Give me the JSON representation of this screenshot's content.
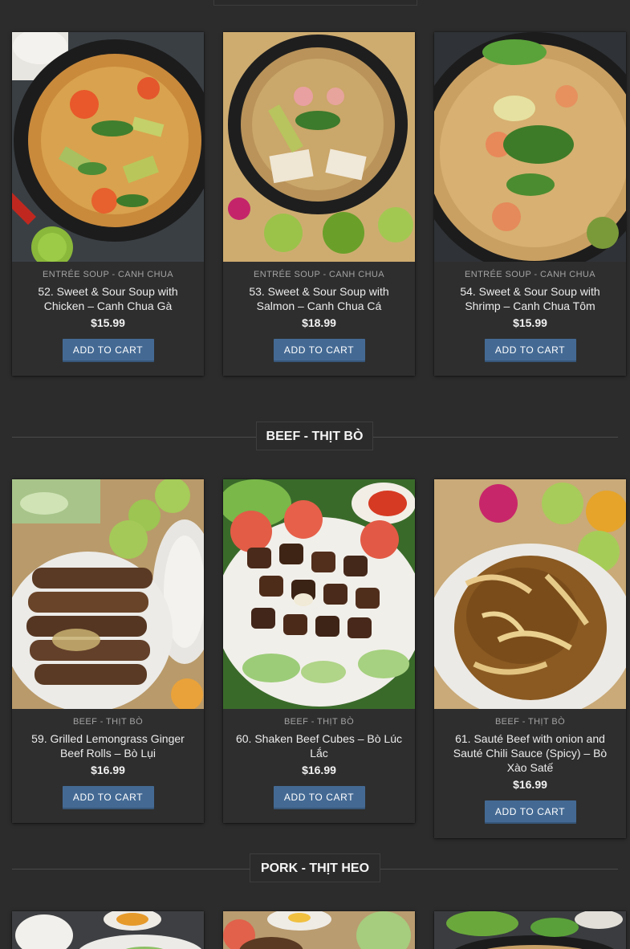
{
  "add_to_cart_label": "ADD TO CART",
  "sections": [
    {
      "title": "BEEF - THỊT BÒ"
    },
    {
      "title": "PORK - THỊT HEO"
    }
  ],
  "products": [
    {
      "category": "ENTRÉE SOUP - CANH CHUA",
      "title": "52. Sweet & Sour Soup with Chicken – Canh Chua Gà",
      "price": "$15.99"
    },
    {
      "category": "ENTRÉE SOUP - CANH CHUA",
      "title": "53. Sweet & Sour Soup with Salmon – Canh Chua Cá",
      "price": "$18.99"
    },
    {
      "category": "ENTRÉE SOUP - CANH CHUA",
      "title": "54. Sweet & Sour Soup with Shrimp – Canh Chua Tôm",
      "price": "$15.99"
    },
    {
      "category": "BEEF - THỊT BÒ",
      "title": "59. Grilled Lemongrass Ginger Beef Rolls – Bò Lụi",
      "price": "$16.99"
    },
    {
      "category": "BEEF - THỊT BÒ",
      "title": "60. Shaken Beef Cubes – Bò Lúc Lắc",
      "price": "$16.99"
    },
    {
      "category": "BEEF - THỊT BÒ",
      "title": "61. Sauté Beef with onion and Sauté Chili Sauce (Spicy) – Bò Xào Satế",
      "price": "$16.99"
    }
  ],
  "colors": {
    "background": "#2c2c2c",
    "card": "#2e2e2e",
    "button": "#446a94",
    "text": "#ececec"
  }
}
